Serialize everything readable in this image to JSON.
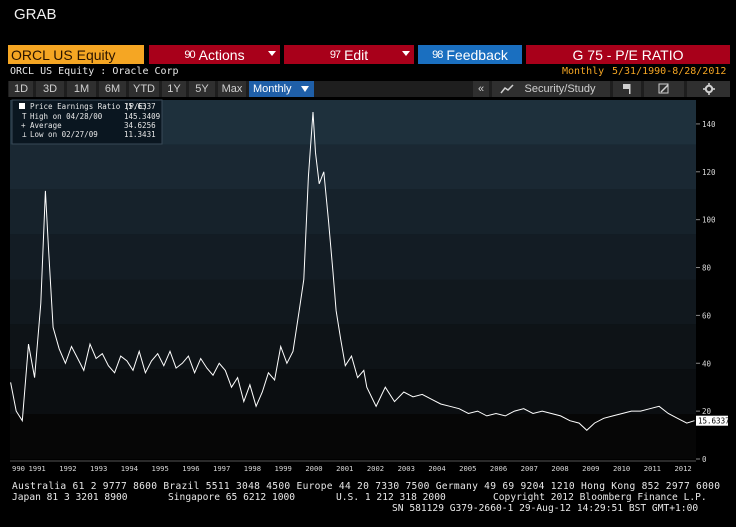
{
  "window": {
    "title": "GRAB"
  },
  "header": {
    "ticker": "ORCL US Equity",
    "actions": {
      "num": "90",
      "label": "Actions"
    },
    "edit": {
      "num": "97",
      "label": "Edit"
    },
    "feedback": {
      "num": "98",
      "label": "Feedback"
    },
    "function_title": "G 75 - P/E RATIO",
    "security_name": "ORCL US Equity : Oracle Corp",
    "period": "Monthly",
    "date_range": "5/31/1990-8/28/2012"
  },
  "toolbar": {
    "ranges": [
      "1D",
      "3D",
      "1M",
      "6M",
      "YTD",
      "1Y",
      "5Y",
      "Max"
    ],
    "frequency": "Monthly",
    "collapse": "«",
    "security_study": "Security/Study"
  },
  "legend": {
    "series_label": "Price Earnings Ratio (P/E)",
    "series_value": "15.6337",
    "high_label": "High on 04/28/00",
    "high_value": "145.3409",
    "avg_label": "Average",
    "avg_value": "34.6256",
    "low_label": "Low on 02/27/09",
    "low_value": "11.3431"
  },
  "footer": {
    "line1": "Australia 61 2 9777 8600 Brazil 5511 3048 4500 Europe 44 20 7330 7500 Germany 49 69 9204 1210 Hong Kong 852 2977 6000",
    "line2a": "Japan 81 3 3201 8900",
    "line2b": "Singapore 65 6212 1000",
    "line2c": "U.S. 1 212 318 2000",
    "line2d": "Copyright 2012 Bloomberg Finance L.P.",
    "line3": "SN 581129 G379-2660-1 29-Aug-12 14:29:51 BST  GMT+1:00"
  },
  "colors": {
    "background": "#000000",
    "accent_orange": "#f5a623",
    "menu_red": "#a8001a",
    "feedback_blue": "#1a6fc0",
    "line": "#ffffff"
  },
  "chart_data": {
    "type": "line",
    "title": "",
    "xlabel": "",
    "ylabel": "",
    "ylim": [
      0,
      150
    ],
    "yticks": [
      0,
      20,
      40,
      60,
      80,
      100,
      120,
      140
    ],
    "xlim": [
      1990.4,
      2012.7
    ],
    "xtick_labels": [
      "990",
      "1991",
      "1992",
      "1993",
      "1994",
      "1995",
      "1996",
      "1997",
      "1998",
      "1999",
      "2000",
      "2001",
      "2002",
      "2003",
      "2004",
      "2005",
      "2006",
      "2007",
      "2008",
      "2009",
      "2010",
      "2011",
      "2012"
    ],
    "last_value_label": "15.6337",
    "grid": false,
    "legend_position": "top-left",
    "series": [
      {
        "name": "Price Earnings Ratio (P/E)",
        "x": [
          1990.42,
          1990.6,
          1990.8,
          1991.0,
          1991.2,
          1991.4,
          1991.55,
          1991.65,
          1991.8,
          1992.0,
          1992.2,
          1992.4,
          1992.6,
          1992.8,
          1993.0,
          1993.2,
          1993.4,
          1993.6,
          1993.8,
          1994.0,
          1994.2,
          1994.4,
          1994.6,
          1994.8,
          1995.0,
          1995.2,
          1995.4,
          1995.6,
          1995.8,
          1996.0,
          1996.2,
          1996.4,
          1996.6,
          1996.8,
          1997.0,
          1997.2,
          1997.4,
          1997.6,
          1997.8,
          1998.0,
          1998.2,
          1998.4,
          1998.6,
          1998.8,
          1999.0,
          1999.2,
          1999.4,
          1999.6,
          1999.8,
          1999.95,
          2000.1,
          2000.25,
          2000.33,
          2000.45,
          2000.6,
          2000.75,
          2000.9,
          2001.0,
          2001.15,
          2001.3,
          2001.5,
          2001.7,
          2001.9,
          2002.0,
          2002.3,
          2002.6,
          2002.9,
          2003.2,
          2003.5,
          2003.8,
          2004.1,
          2004.4,
          2004.7,
          2005.0,
          2005.3,
          2005.6,
          2005.9,
          2006.2,
          2006.5,
          2006.8,
          2007.1,
          2007.4,
          2007.7,
          2008.0,
          2008.3,
          2008.6,
          2008.9,
          2009.15,
          2009.4,
          2009.7,
          2010.0,
          2010.3,
          2010.6,
          2010.9,
          2011.2,
          2011.5,
          2011.8,
          2012.1,
          2012.4,
          2012.65
        ],
        "y": [
          32,
          20,
          16,
          48,
          34,
          65,
          112,
          88,
          55,
          46,
          40,
          47,
          42,
          37,
          48,
          42,
          44,
          39,
          36,
          43,
          41,
          37,
          45,
          36,
          41,
          44,
          39,
          45,
          38,
          40,
          43,
          36,
          42,
          38,
          35,
          40,
          37,
          30,
          34,
          24,
          31,
          22,
          28,
          36,
          33,
          47,
          40,
          45,
          62,
          75,
          118,
          145,
          128,
          115,
          120,
          100,
          78,
          62,
          50,
          39,
          43,
          34,
          37,
          30,
          22,
          30,
          24,
          28,
          26,
          27,
          25,
          23,
          22,
          21,
          19,
          20,
          18,
          19,
          18,
          20,
          21,
          19,
          20,
          19,
          18,
          16,
          15,
          12,
          15,
          17,
          18,
          19,
          20,
          20,
          21,
          22,
          19,
          17,
          15,
          16
        ]
      }
    ]
  }
}
